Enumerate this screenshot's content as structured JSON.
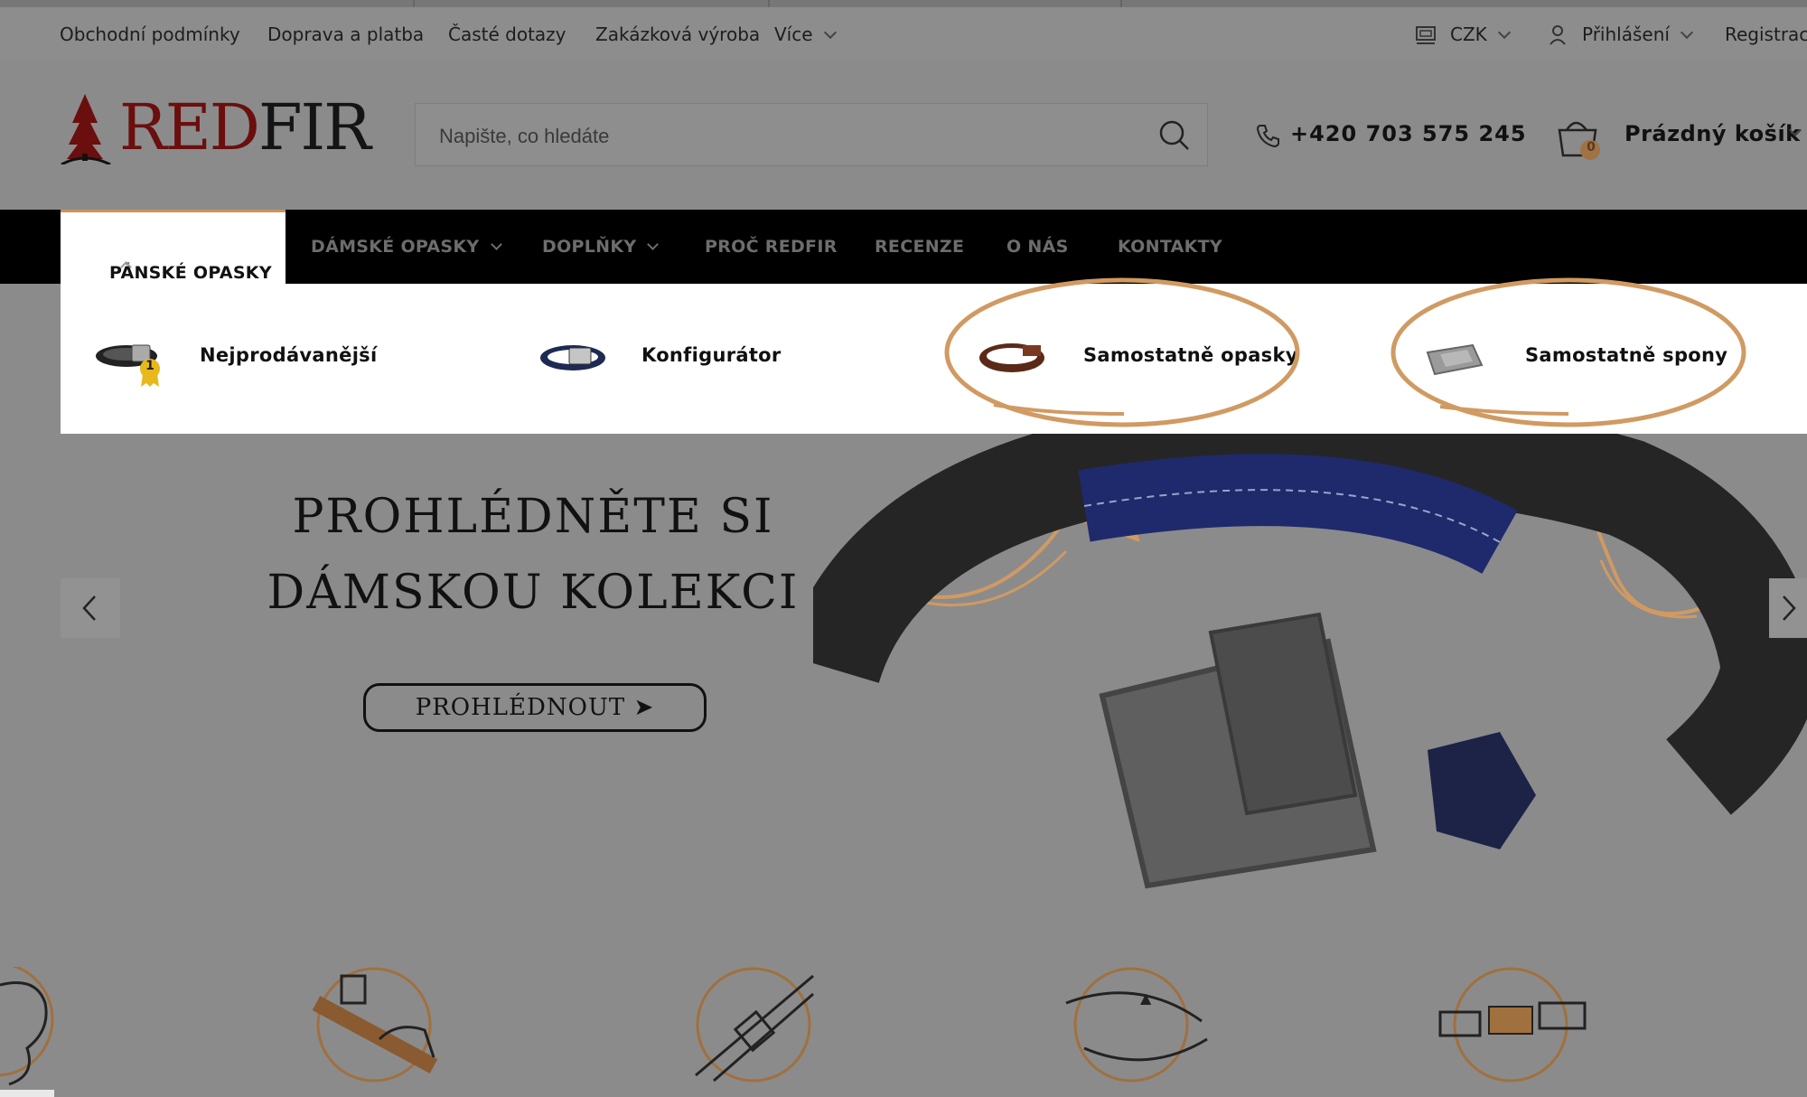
{
  "topbar": {
    "links": [
      "Obchodní podmínky",
      "Doprava a platba",
      "Časté dotazy",
      "Zakázková výroba",
      "Více"
    ],
    "currency": "CZK",
    "login": "Přihlášení",
    "register": "Registrace"
  },
  "header": {
    "logo_red": "RED",
    "logo_black": "FIR",
    "search_placeholder": "Napište, co hledáte",
    "phone": "+420 703 575 245",
    "cart_count": "0",
    "cart_label": "Prázdný košík"
  },
  "nav": {
    "active": "PÁNSKÉ OPASKY",
    "items": [
      "DÁMSKÉ OPASKY",
      "DOPLŇKY",
      "PROČ REDFIR",
      "RECENZE",
      "O NÁS",
      "KONTAKTY"
    ]
  },
  "dropdown": {
    "items": [
      "Nejprodávanější",
      "Konfigurátor",
      "Samostatně opasky",
      "Samostatně spony"
    ],
    "badge": "1"
  },
  "hero": {
    "title_line1": "PROHLÉDNĚTE SI",
    "title_line2": "DÁMSKOU KOLEKCI",
    "button": "PROHLÉDNOUT ➤"
  },
  "colors": {
    "accent": "#c9925a",
    "overlay": "#8b8b8b",
    "logo_red": "#6b0e0e"
  }
}
